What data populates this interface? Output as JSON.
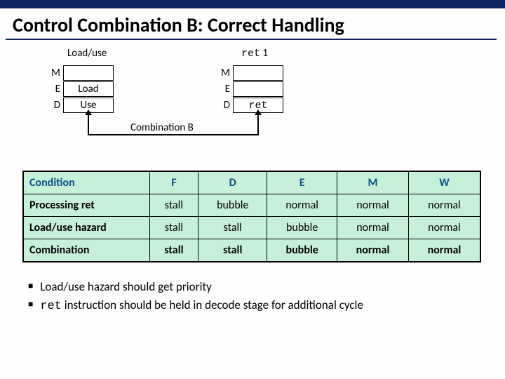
{
  "title": "Control Combination B: Correct Handling",
  "left": {
    "heading": "Load/use",
    "stages": {
      "m": "M",
      "e": "E",
      "d": "D"
    },
    "e_box": "Load",
    "d_box": "Use"
  },
  "right": {
    "heading_prefix": "ret",
    "heading_suffix": " 1",
    "stages": {
      "m": "M",
      "e": "E",
      "d": "D"
    },
    "d_box": "ret"
  },
  "comb_label": "Combination B",
  "table": {
    "headers": {
      "condition": "Condition",
      "f": "F",
      "d": "D",
      "e": "E",
      "m": "M",
      "w": "W"
    },
    "rows": [
      {
        "condition": "Processing ret",
        "f": "stall",
        "d": "bubble",
        "e": "normal",
        "m": "normal",
        "w": "normal",
        "bold": false
      },
      {
        "condition": "Load/use hazard",
        "f": "stall",
        "d": "stall",
        "e": "bubble",
        "m": "normal",
        "w": "normal",
        "bold": false
      },
      {
        "condition": "Combination",
        "f": "stall",
        "d": "stall",
        "e": "bubble",
        "m": "normal",
        "w": "normal",
        "bold": true
      }
    ]
  },
  "bullets": {
    "b1": "Load/use hazard should get priority",
    "b2_prefix": "ret",
    "b2_rest": " instruction should be held in decode stage for additional cycle"
  }
}
